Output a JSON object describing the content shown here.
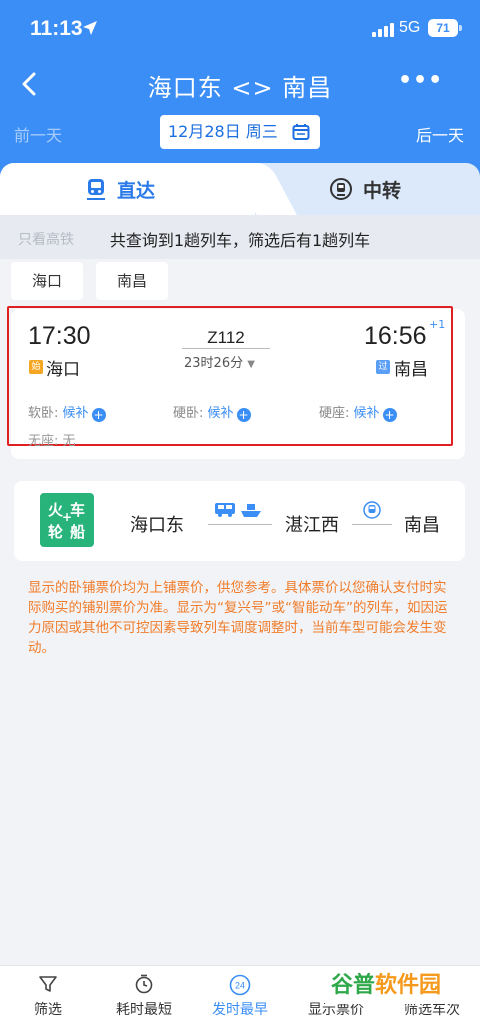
{
  "status_bar": {
    "time": "11:13",
    "network": "5G",
    "battery": "71"
  },
  "nav": {
    "title": "海口东 <> 南昌"
  },
  "date_row": {
    "prev_day": "前一天",
    "date": "12月28日 周三",
    "next_day": "后一天"
  },
  "tabs": [
    {
      "label": "直达"
    },
    {
      "label": "中转"
    }
  ],
  "results": {
    "hint": "只看高铁",
    "summary": "共查询到1趟列车，筛选后有1趟列车"
  },
  "filters": {
    "from_chip": "海口",
    "to_chip": "南昌"
  },
  "train": {
    "departure_time": "17:30",
    "departure_station": "海口",
    "departure_badge": "始",
    "train_number": "Z112",
    "duration": "23时26分",
    "arrival_time": "16:56",
    "arrival_day_offset": "+1",
    "arrival_station": "南昌",
    "arrival_badge": "过",
    "seats": [
      {
        "type": "软卧:",
        "status": "候补"
      },
      {
        "type": "硬卧:",
        "status": "候补"
      },
      {
        "type": "硬座:",
        "status": "候补"
      },
      {
        "type": "无座:",
        "status": "无"
      }
    ]
  },
  "transfer": {
    "logo_chars": [
      "火",
      "车",
      "轮",
      "船"
    ],
    "stations": [
      "海口东",
      "湛江西",
      "南昌"
    ]
  },
  "notice": "显示的卧铺票价均为上铺票价，供您参考。具体票价以您确认支付时实际购买的铺别票价为准。显示为“复兴号”或“智能动车”的列车，如因运力原因或其他不可控因素导致列车调度调整时，当前车型可能会发生变动。",
  "bottom_bar": {
    "items": [
      {
        "label": "筛选"
      },
      {
        "label": "耗时最短"
      },
      {
        "label": "发时最早",
        "icon_text": "24"
      },
      {
        "label": "显示票价"
      },
      {
        "label": "筛选车次"
      }
    ]
  },
  "watermark": {
    "part1": "谷普",
    "part2": "软件园"
  },
  "colors": {
    "primary": "#3b8ef6",
    "highlight": "#e02020",
    "warning": "#f07c2a",
    "ship": "#27b37a"
  }
}
